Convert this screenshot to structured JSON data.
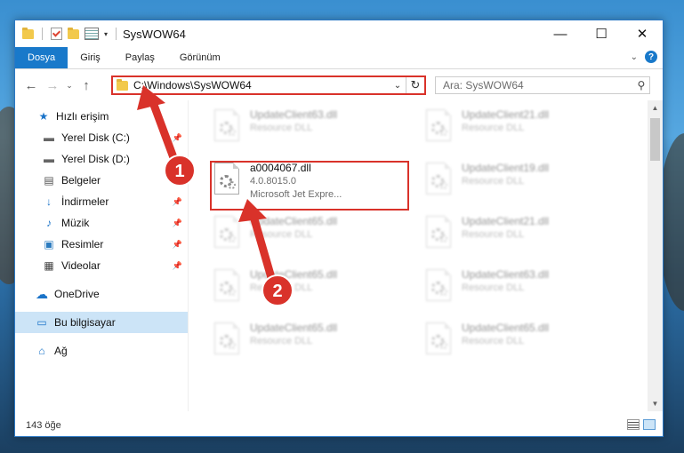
{
  "titlebar": {
    "title": "SysWOW64",
    "minimize": "—",
    "maximize": "☐",
    "close": "✕"
  },
  "ribbon": {
    "tabs": [
      "Dosya",
      "Giriş",
      "Paylaş",
      "Görünüm"
    ],
    "help": "?"
  },
  "nav": {
    "address": "C:\\Windows\\SysWOW64",
    "search_placeholder": "Ara: SysWOW64"
  },
  "sidebar": {
    "items": [
      {
        "label": "Hızlı erişim",
        "icon": "star-icon"
      },
      {
        "label": "Yerel Disk (C:)",
        "icon": "drive-icon",
        "pinned": true
      },
      {
        "label": "Yerel Disk (D:)",
        "icon": "drive-icon"
      },
      {
        "label": "Belgeler",
        "icon": "document-icon",
        "pinned": true
      },
      {
        "label": "İndirmeler",
        "icon": "download-icon",
        "pinned": true
      },
      {
        "label": "Müzik",
        "icon": "music-icon",
        "pinned": true
      },
      {
        "label": "Resimler",
        "icon": "pictures-icon",
        "pinned": true
      },
      {
        "label": "Videolar",
        "icon": "video-icon",
        "pinned": true
      },
      {
        "label": "OneDrive",
        "icon": "cloud-icon"
      },
      {
        "label": "Bu bilgisayar",
        "icon": "computer-icon",
        "selected": true
      },
      {
        "label": "Ağ",
        "icon": "network-icon"
      }
    ]
  },
  "files": [
    {
      "name": "UpdateClient63.dll",
      "sub": "Resource DLL",
      "blur": true
    },
    {
      "name": "UpdateClient21.dll",
      "sub": "Resource DLL",
      "blur": true
    },
    {
      "name": "a0004067.dll",
      "sub": "4.0.8015.0",
      "sub2": "Microsoft Jet Expre...",
      "blur": false
    },
    {
      "name": "UpdateClient19.dll",
      "sub": "Resource DLL",
      "blur": true
    },
    {
      "name": "UpdateClient65.dll",
      "sub": "Resource DLL",
      "blur": true
    },
    {
      "name": "UpdateClient21.dll",
      "sub": "Resource DLL",
      "blur": true
    },
    {
      "name": "UpdateClient65.dll",
      "sub": "Resource DLL",
      "blur": true
    },
    {
      "name": "UpdateClient63.dll",
      "sub": "Resource DLL",
      "blur": true
    },
    {
      "name": "UpdateClient65.dll",
      "sub": "Resource DLL",
      "blur": true
    },
    {
      "name": "UpdateClient65.dll",
      "sub": "Resource DLL",
      "blur": true
    }
  ],
  "status": {
    "count": "143 öğe"
  },
  "annotations": {
    "step1": "1",
    "step2": "2",
    "accent": "#d9322a"
  },
  "colors": {
    "file_tab": "#1979ca",
    "selection": "#cce4f7",
    "highlight": "#d9322a"
  }
}
